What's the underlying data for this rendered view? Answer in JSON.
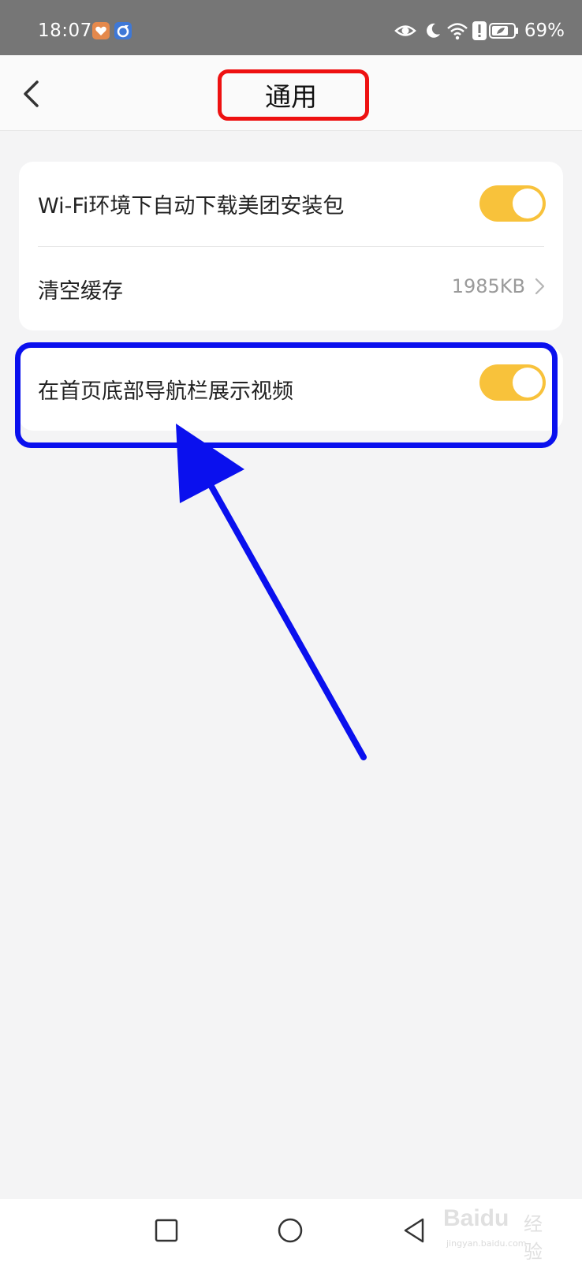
{
  "status_bar": {
    "time": "18:07",
    "battery": "69%",
    "icons": [
      "heart-app-icon",
      "browser-app-icon",
      "eye-icon",
      "moon-icon",
      "wifi-icon",
      "alert-icon",
      "battery-icon"
    ]
  },
  "header": {
    "title": "通用",
    "back_icon": "chevron-left-icon"
  },
  "settings": {
    "group1": [
      {
        "label": "Wi-Fi环境下自动下载美团安装包",
        "type": "toggle",
        "on": true
      },
      {
        "label": "清空缓存",
        "type": "link",
        "value": "1985KB"
      }
    ],
    "group2": [
      {
        "label": "在首页底部导航栏展示视频",
        "type": "toggle",
        "on": true
      }
    ]
  },
  "annotations": {
    "title_highlight_color": "#ee1111",
    "row_highlight_color": "#0a10ee"
  },
  "nav_bar": {
    "buttons": [
      "recent-apps-icon",
      "home-icon",
      "back-triangle-icon"
    ]
  },
  "watermark": {
    "logo": "Baidu",
    "brand": "经验",
    "url": "jingyan.baidu.com"
  },
  "colors": {
    "toggle_on": "#f8c23b",
    "status_bar_bg": "#767676",
    "page_bg": "#f4f4f5"
  }
}
